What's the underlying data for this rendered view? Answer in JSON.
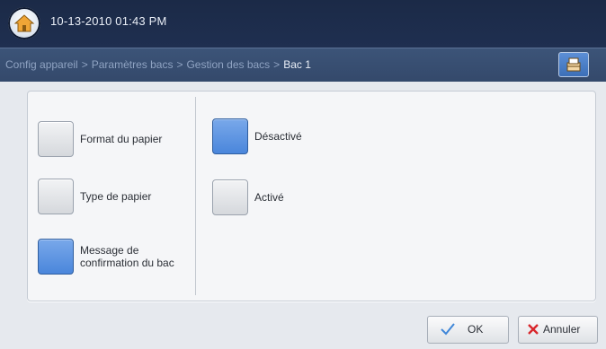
{
  "header": {
    "datetime": "10-13-2010 01:43 PM",
    "home_icon": "home-icon"
  },
  "breadcrumb": {
    "items": [
      "Config appareil",
      "Paramètres bacs",
      "Gestion des bacs",
      "Bac 1"
    ],
    "separator": ">",
    "tray_icon": "tray-icon"
  },
  "left_menu": [
    {
      "label": "Format du papier",
      "selected": false
    },
    {
      "label": "Type de papier",
      "selected": false
    },
    {
      "label_line1": "Message de",
      "label_line2": "confirmation du bac",
      "selected": true
    }
  ],
  "right_options": [
    {
      "label": "Désactivé",
      "selected": true
    },
    {
      "label": "Activé",
      "selected": false
    }
  ],
  "footer": {
    "ok_label": "OK",
    "cancel_label": "Annuler"
  },
  "colors": {
    "accent": "#4a86db",
    "topbar": "#1f2f50",
    "breadcrumb_bg": "#3c5478",
    "ok_check": "#3f86d8",
    "cancel_x": "#d8262b"
  }
}
